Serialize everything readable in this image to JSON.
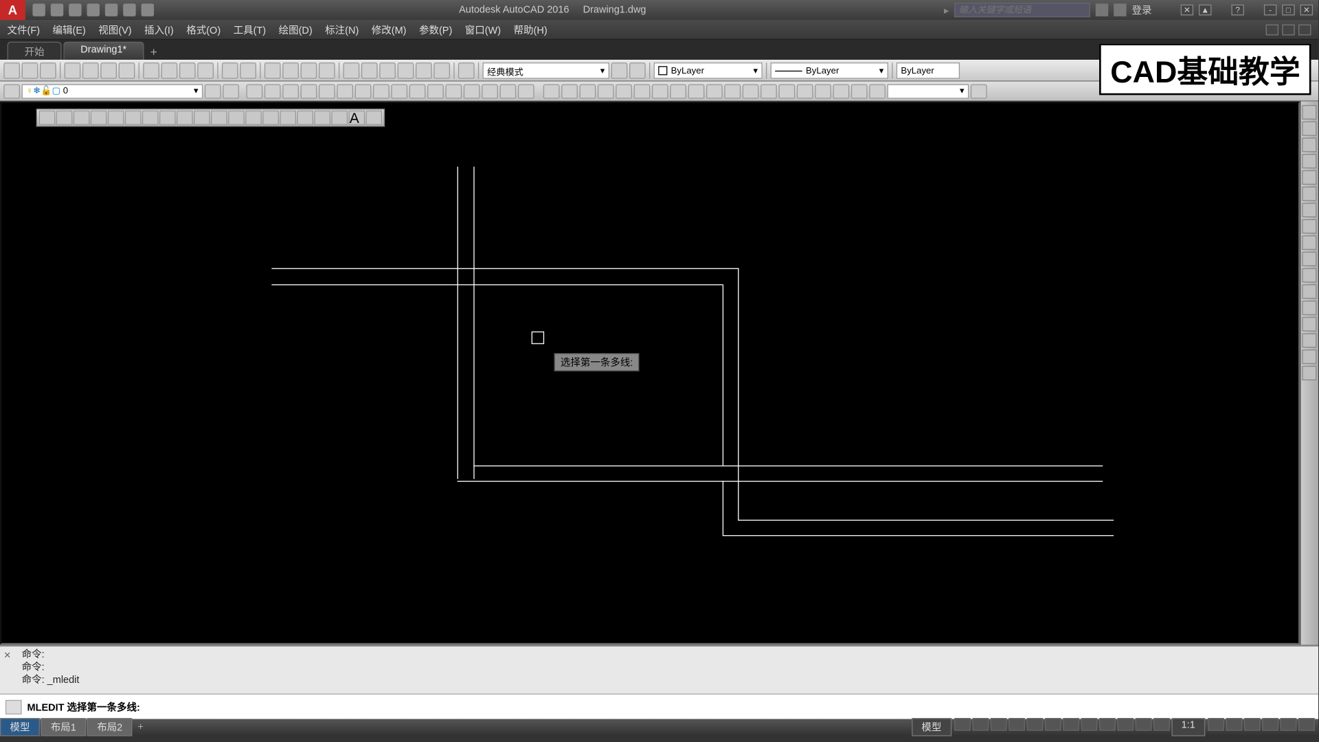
{
  "title": {
    "app": "Autodesk AutoCAD 2016",
    "doc": "Drawing1.dwg"
  },
  "search_placeholder": "输入关键字或短语",
  "login": "登录",
  "menus": [
    "文件(F)",
    "编辑(E)",
    "视图(V)",
    "插入(I)",
    "格式(O)",
    "工具(T)",
    "绘图(D)",
    "标注(N)",
    "修改(M)",
    "参数(P)",
    "窗口(W)",
    "帮助(H)"
  ],
  "doctabs": {
    "start": "开始",
    "current": "Drawing1*",
    "plus": "+"
  },
  "workspace_combo": "经典模式",
  "layer_combo": "0",
  "bylayer1": "ByLayer",
  "bylayer2": "ByLayer",
  "bylayer3": "ByLayer",
  "tooltip": "选择第一条多线:",
  "cmd_history": [
    "命令:",
    "命令:",
    "命令: _mledit"
  ],
  "cmd_prompt": "MLEDIT 选择第一条多线:",
  "status_tabs": {
    "model": "模型",
    "layout1": "布局1",
    "layout2": "布局2",
    "plus": "+"
  },
  "status_right": {
    "model_btn": "模型",
    "scale": "1:1"
  },
  "watermark": "CAD基础教学",
  "qat_icons": [
    "new",
    "open",
    "save",
    "saveas",
    "print",
    "undo",
    "redo"
  ],
  "title_right_icons": [
    "exchange",
    "user",
    "help",
    "min",
    "restore",
    "close"
  ],
  "toolbar1_icons": [
    "qnew",
    "open",
    "save",
    "plot",
    "preview",
    "publish",
    "cut",
    "copy",
    "paste",
    "matchprop",
    "undo",
    "redo",
    "pan",
    "zoom",
    "zoomwin",
    "zoomprev",
    "props",
    "sheetset",
    "markup",
    "qcalc",
    "layers",
    "help"
  ],
  "toolbar2_left_icons": [
    "layer"
  ],
  "toolbar2_mid_icons": [
    "layeriso",
    "layerfrz",
    "layeroff",
    "layerlock",
    "layerunlock",
    "layerprev",
    "layerstate",
    "layermatch",
    "laywalk",
    "linetype",
    "lineweight"
  ],
  "toolbar2_dim_icons": [
    "linear",
    "aligned",
    "arc",
    "ordinate",
    "radius",
    "diameter",
    "angular",
    "quick",
    "baseline",
    "continue",
    "tolerance",
    "center",
    "edit",
    "textedit",
    "update",
    "style"
  ],
  "draw_icons": [
    "line",
    "xline",
    "pline",
    "polygon",
    "rect",
    "arc",
    "circle",
    "revcloud",
    "spline",
    "ellipse",
    "ellipsearc",
    "insert",
    "block",
    "point",
    "hatch",
    "gradient",
    "region",
    "table",
    "mtext",
    "addsel"
  ],
  "palette_icons": [
    "prop",
    "wheel",
    "shx",
    "pan",
    "orbit",
    "color",
    "lwt",
    "tp",
    "mat",
    "paste",
    "dim",
    "wipe",
    "cloud",
    "grp",
    "app",
    "sheet",
    "xref"
  ],
  "status_icons": [
    "grid",
    "snap",
    "infer",
    "dynuc",
    "ortho",
    "polar",
    "iso",
    "osnap",
    "3dosnap",
    "otrack",
    "lwt",
    "transp",
    "cycle",
    "plus",
    "custom",
    "full",
    "clean",
    "iso2",
    "hw"
  ]
}
